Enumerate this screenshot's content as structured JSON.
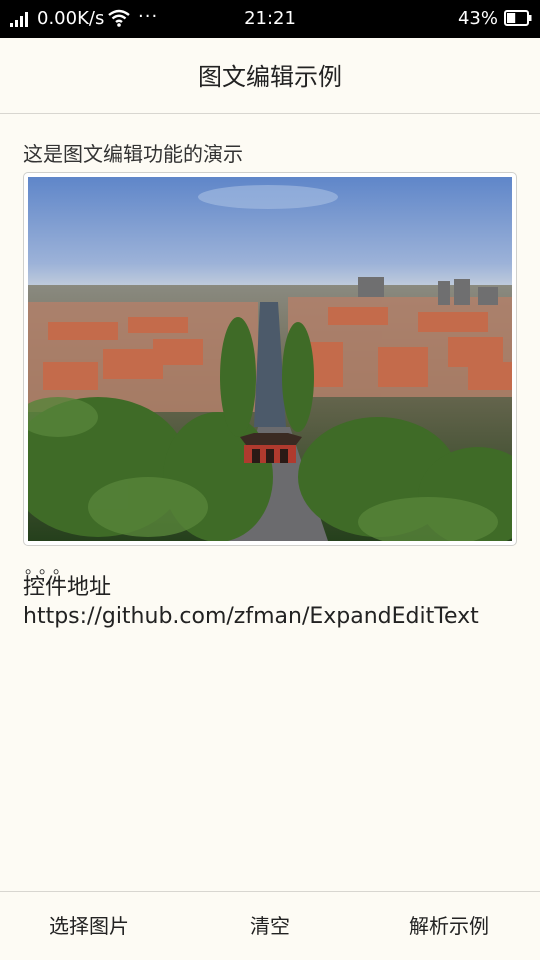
{
  "status_bar": {
    "network_speed": "0.00K/s",
    "more": "···",
    "time": "21:21",
    "battery_percent": "43%",
    "battery_level": 0.43,
    "icons": [
      "signal-icon",
      "wifi-icon",
      "battery-icon"
    ]
  },
  "header": {
    "title": "图文编辑示例"
  },
  "editor": {
    "intro_text": "这是图文编辑功能的演示",
    "image": "aerial-campus-photo",
    "dots": "。。。",
    "label": "控件地址",
    "url": "https://github.com/zfman/ExpandEditText"
  },
  "bottom_bar": {
    "select_image": "选择图片",
    "clear": "清空",
    "parse_example": "解析示例"
  },
  "colors": {
    "background": "#fdfbf4",
    "status_bar": "#000000",
    "text": "#222222",
    "divider": "#d8d6d0"
  }
}
